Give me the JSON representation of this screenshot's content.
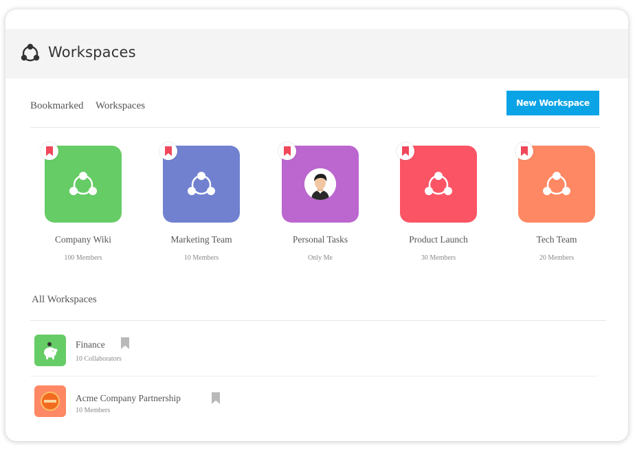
{
  "header": {
    "title": "Workspaces"
  },
  "tabs": [
    "Bookmarked",
    "Workspaces"
  ],
  "new_button": "New Workspace",
  "bookmarked": [
    {
      "name": "Company Wiki",
      "sub": "100 Members",
      "color": "#66cc66"
    },
    {
      "name": "Marketing  Team",
      "sub": "10 Members",
      "color": "#7181d0"
    },
    {
      "name": "Personal  Tasks",
      "sub": "Only Me",
      "color": "#bb67cf"
    },
    {
      "name": "Product Launch",
      "sub": "30 Members",
      "color": "#fb5465"
    },
    {
      "name": "Tech  Team",
      "sub": "20 Members",
      "color": "#fe8863"
    }
  ],
  "all_title": "All Workspaces",
  "all": [
    {
      "name": "Finance",
      "sub": "10 Collaborators",
      "color": "#66cc66",
      "icon": "piggy-bank-icon"
    },
    {
      "name": "Acme Company Partnership",
      "sub": "10 Members",
      "color": "#fe8863",
      "icon": "acme-logo-icon"
    }
  ],
  "colors": {
    "accent": "#0aa4e6",
    "bookmark": "#f0485a"
  }
}
